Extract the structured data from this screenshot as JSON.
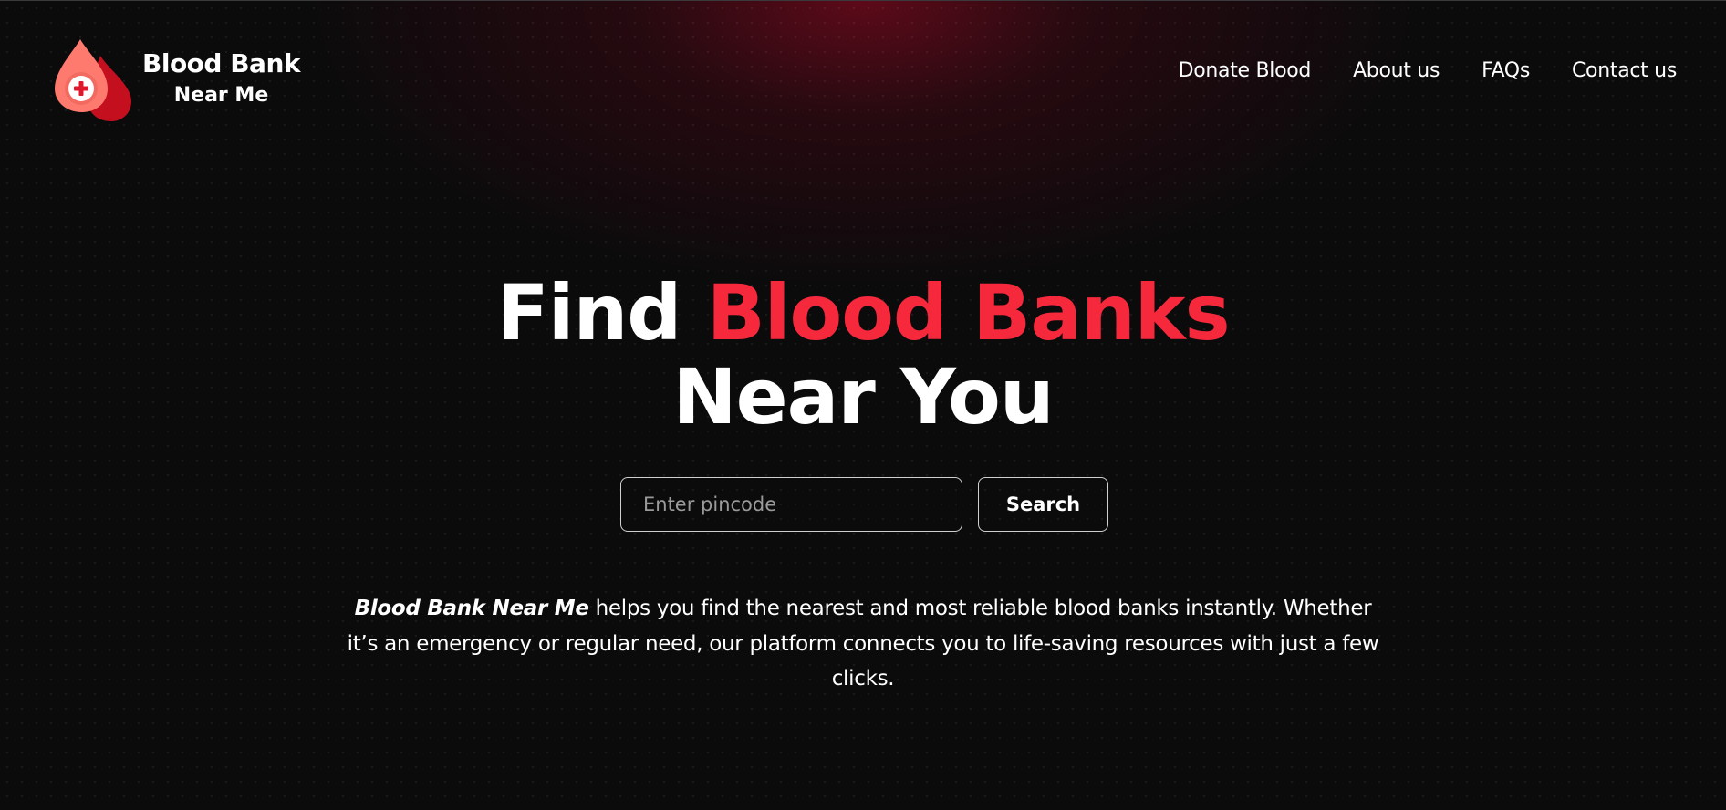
{
  "brand": {
    "line1": "Blood Bank",
    "line2": "Near Me",
    "logo_icon": "blood-drop-medical-cross-icon"
  },
  "nav": {
    "items": [
      {
        "label": "Donate Blood"
      },
      {
        "label": "About us"
      },
      {
        "label": "FAQs"
      },
      {
        "label": "Contact us"
      }
    ]
  },
  "hero": {
    "title_part1": "Find ",
    "title_accent": "Blood Banks",
    "title_line2": "Near You"
  },
  "search": {
    "placeholder": "Enter pincode",
    "value": "",
    "button_label": "Search"
  },
  "description": {
    "emphasis": "Blood Bank Near Me",
    "text": " helps you find the nearest and most reliable blood banks instantly. Whether it’s an emergency or regular need, our platform connects you to life-saving resources with just a few clicks."
  },
  "colors": {
    "accent": "#f6283c",
    "background": "#0b0b0c",
    "glow": "#780a1e",
    "border": "#cfcfcf"
  }
}
